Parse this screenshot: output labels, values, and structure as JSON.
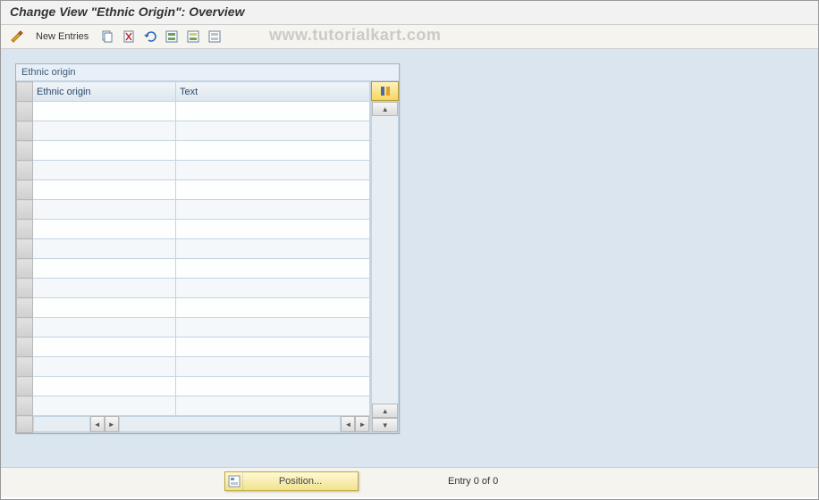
{
  "title": "Change View \"Ethnic Origin\": Overview",
  "toolbar": {
    "new_entries_label": "New Entries"
  },
  "watermark": "www.tutorialkart.com",
  "panel": {
    "title": "Ethnic origin",
    "columns": {
      "ethnic_origin": "Ethnic origin",
      "text": "Text"
    },
    "rows": [
      {
        "ethnic_origin": "",
        "text": ""
      },
      {
        "ethnic_origin": "",
        "text": ""
      },
      {
        "ethnic_origin": "",
        "text": ""
      },
      {
        "ethnic_origin": "",
        "text": ""
      },
      {
        "ethnic_origin": "",
        "text": ""
      },
      {
        "ethnic_origin": "",
        "text": ""
      },
      {
        "ethnic_origin": "",
        "text": ""
      },
      {
        "ethnic_origin": "",
        "text": ""
      },
      {
        "ethnic_origin": "",
        "text": ""
      },
      {
        "ethnic_origin": "",
        "text": ""
      },
      {
        "ethnic_origin": "",
        "text": ""
      },
      {
        "ethnic_origin": "",
        "text": ""
      },
      {
        "ethnic_origin": "",
        "text": ""
      },
      {
        "ethnic_origin": "",
        "text": ""
      },
      {
        "ethnic_origin": "",
        "text": ""
      },
      {
        "ethnic_origin": "",
        "text": ""
      }
    ]
  },
  "footer": {
    "position_label": "Position...",
    "entry_count": "Entry 0 of 0"
  }
}
